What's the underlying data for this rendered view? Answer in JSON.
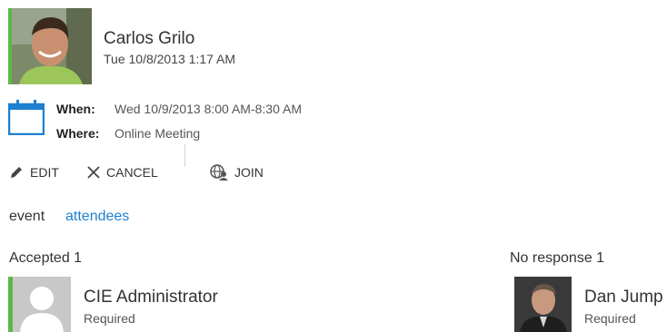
{
  "sender": {
    "name": "Carlos Grilo",
    "sent_time": "Tue 10/8/2013 1:17 AM",
    "presence_color": "#5cb84a"
  },
  "details": {
    "when_label": "When:",
    "when_value": "Wed 10/9/2013 8:00 AM-8:30 AM",
    "where_label": "Where:",
    "where_value": "Online Meeting"
  },
  "toolbar": {
    "edit_label": "EDIT",
    "cancel_label": "CANCEL",
    "join_label": "JOIN"
  },
  "tabs": {
    "event_label": "event",
    "attendees_label": "attendees",
    "active": "attendees",
    "active_color": "#1e80d0"
  },
  "groups": {
    "accepted": {
      "header": "Accepted 1",
      "attendees": [
        {
          "name": "CIE Administrator",
          "role": "Required"
        }
      ]
    },
    "no_response": {
      "header": "No response 1",
      "attendees": [
        {
          "name": "Dan Jump",
          "role": "Required"
        }
      ]
    }
  }
}
